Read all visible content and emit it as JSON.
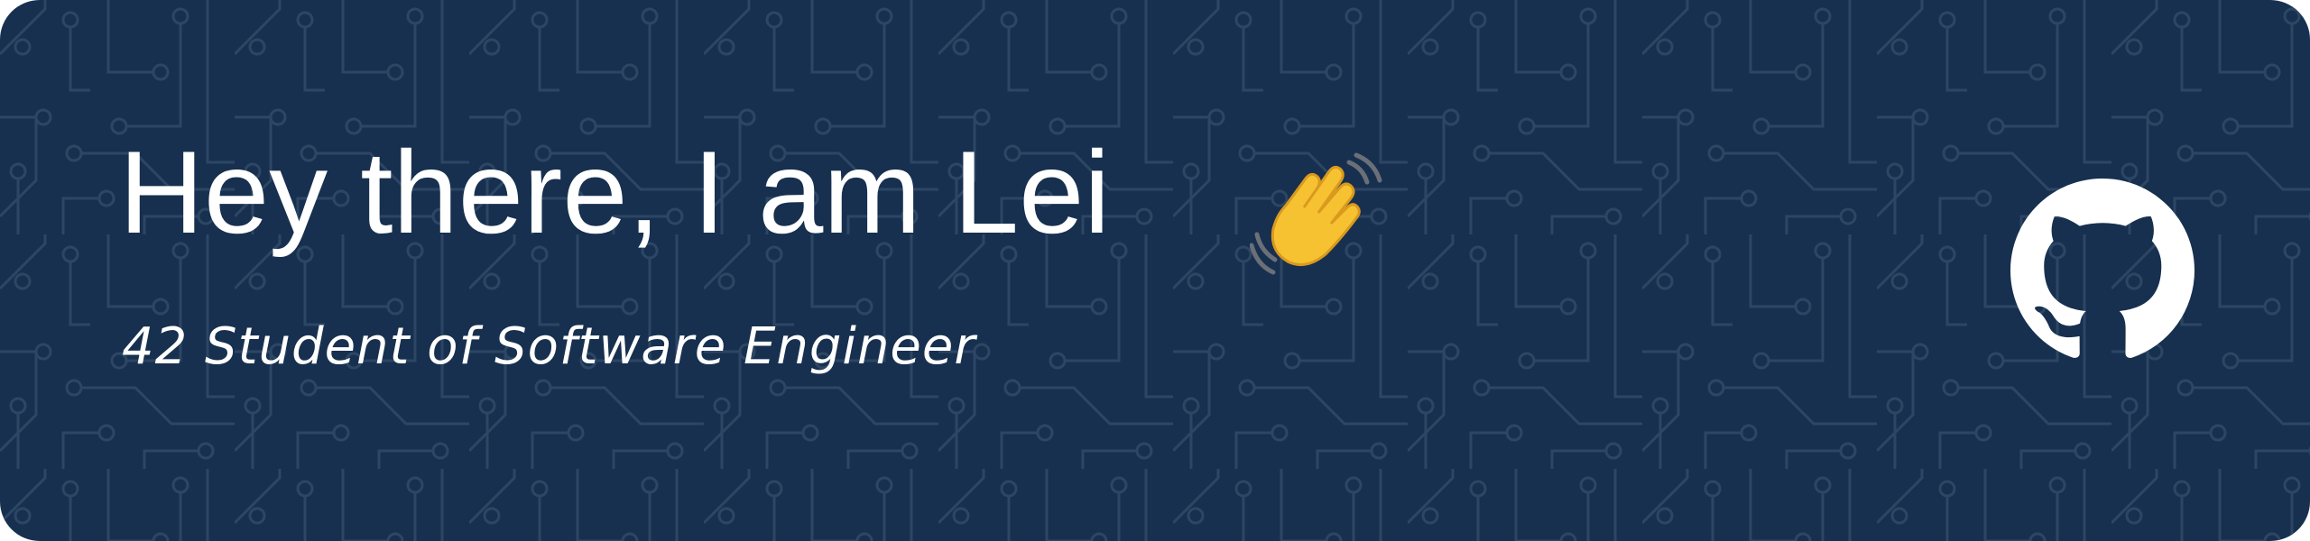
{
  "banner": {
    "title": "Hey there, I am Lei",
    "title_emoji": "waving-hand-icon",
    "subtitle": "42 Student of Software Engineer",
    "link_icon": "github-icon"
  },
  "colors": {
    "background": "#17304f",
    "circuit": "#2c4664",
    "text": "#ffffff",
    "emoji": "#f7c232"
  }
}
